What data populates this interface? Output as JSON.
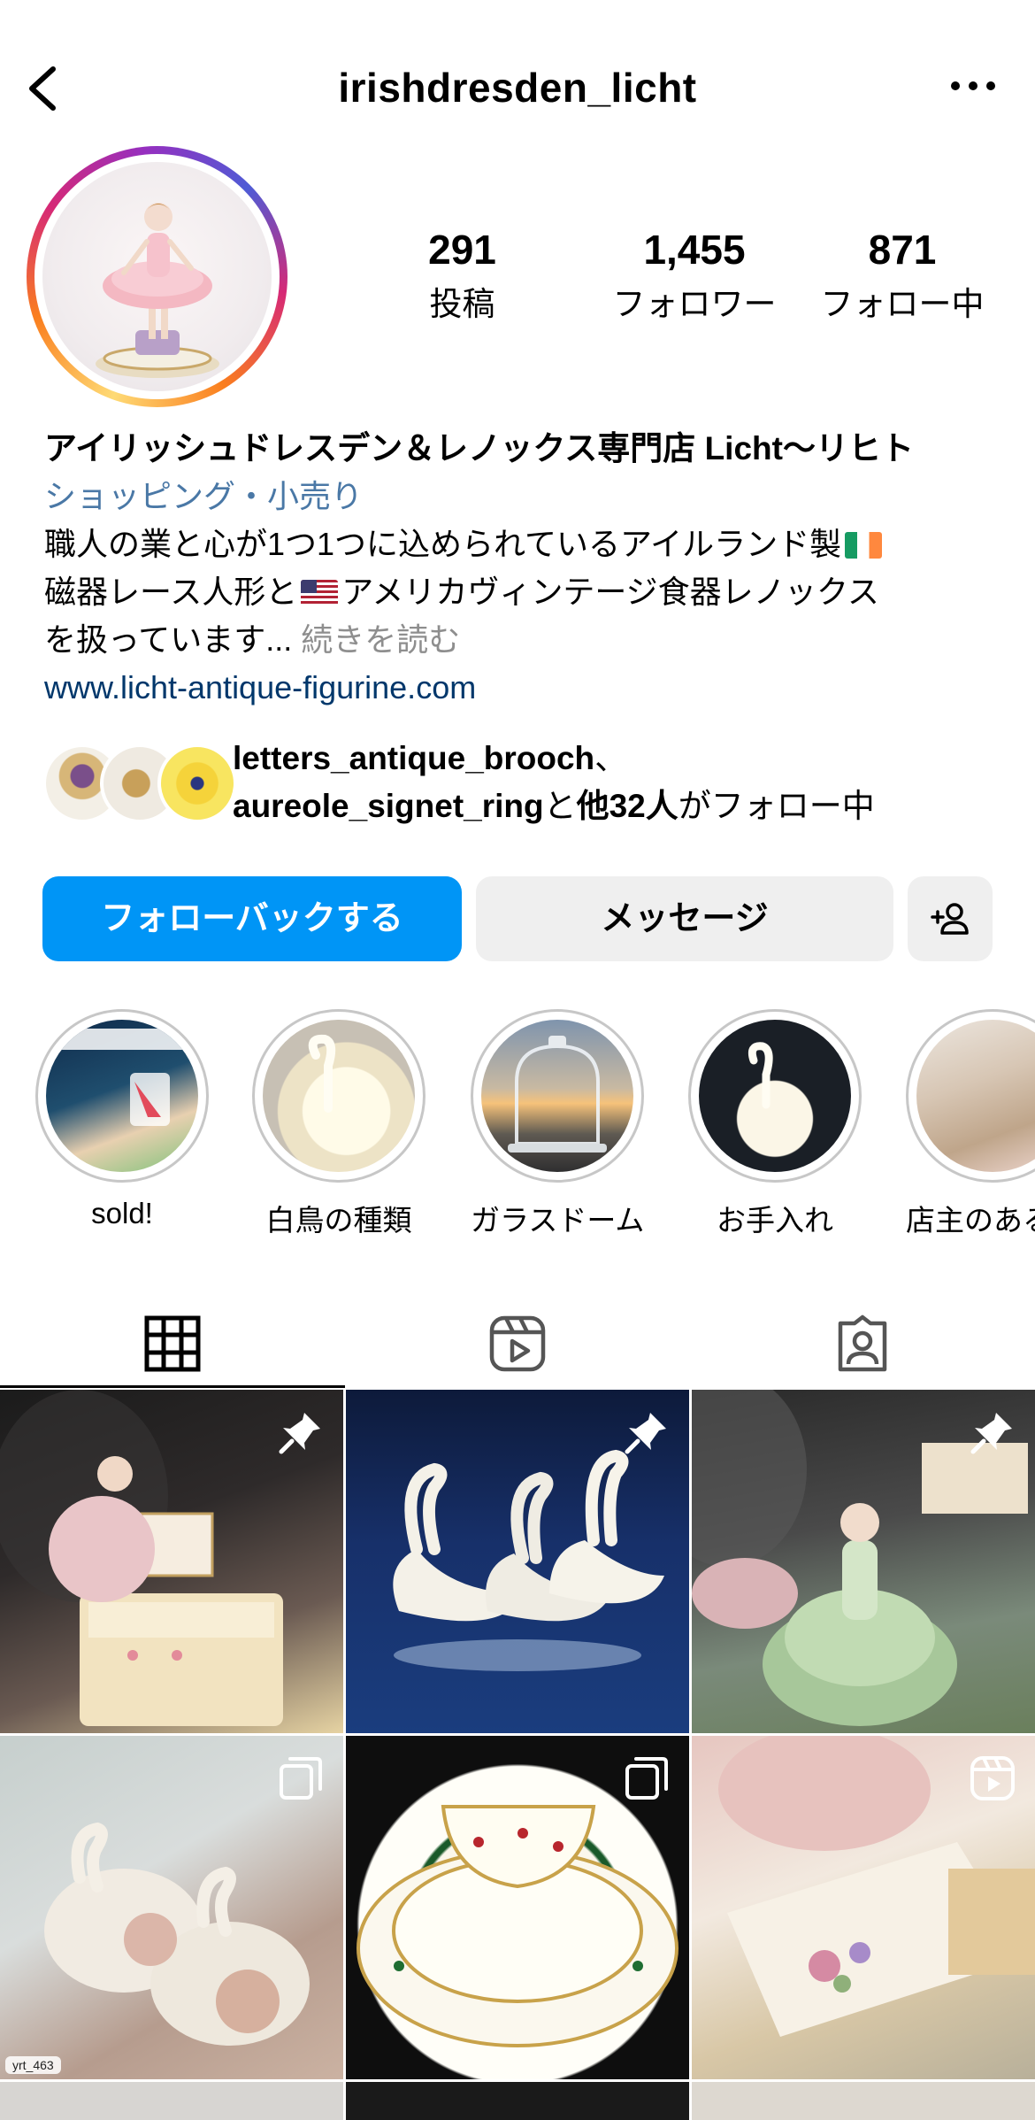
{
  "header": {
    "username": "irishdresden_licht",
    "back_icon": "chevron-left-icon",
    "more_icon": "more-horizontal-icon"
  },
  "stats": {
    "posts": {
      "value": "291",
      "label": "投稿"
    },
    "followers": {
      "value": "1,455",
      "label": "フォロワー"
    },
    "following": {
      "value": "871",
      "label": "フォロー中"
    }
  },
  "bio": {
    "name": "アイリッシュドレスデン＆レノックス専門店 Licht〜リヒト",
    "category": "ショッピング・小売り",
    "line1": "職人の業と心が1つ1つに込められているアイルランド製",
    "line2_a": "磁器レース人形と",
    "line2_b": "アメリカヴィンテージ食器レノックス",
    "line3": "を扱っています...",
    "more": "続きを読む",
    "link": "www.licht-antique-figurine.com"
  },
  "followed_by": {
    "user1": "letters_antique_brooch",
    "separator": "、",
    "user2": "aureole_signet_ring",
    "mid": "と",
    "others": "他32人",
    "suffix": "がフォロー中"
  },
  "buttons": {
    "follow_back": "フォローバックする",
    "message": "メッセージ",
    "add_user_icon": "add-user-icon"
  },
  "highlights": [
    {
      "label": "sold!"
    },
    {
      "label": "白鳥の種類"
    },
    {
      "label": "ガラスドーム"
    },
    {
      "label": "お手入れ"
    },
    {
      "label": "店主のある"
    }
  ],
  "tabs": [
    {
      "name": "grid-icon",
      "active": true
    },
    {
      "name": "reels-icon",
      "active": false
    },
    {
      "name": "tagged-icon",
      "active": false
    }
  ],
  "grid": {
    "repost_user": "yrt_463"
  },
  "colors": {
    "primary_blue": "#0095f6",
    "link_blue": "#00376b",
    "category_blue": "#4a78a6",
    "button_gray": "#efefef",
    "muted_gray": "#8e8e8e"
  }
}
